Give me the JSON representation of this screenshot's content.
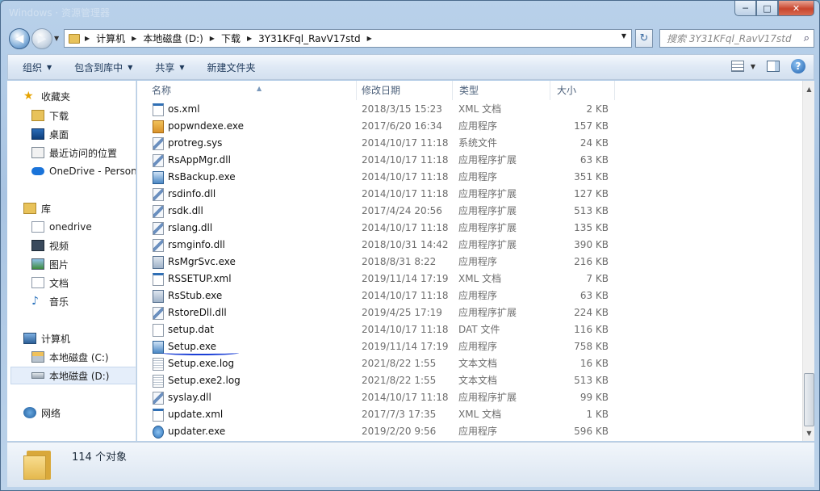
{
  "window": {
    "ghost_title": "Windows · 资源管理器",
    "controls": {
      "minimize": "─",
      "maximize": "□",
      "close": "✕"
    }
  },
  "nav": {
    "back_icon": "back-arrow-icon",
    "forward_icon": "forward-arrow-icon",
    "breadcrumb": [
      "计算机",
      "本地磁盘 (D:)",
      "下载",
      "3Y31KFql_RavV17std"
    ],
    "search_placeholder": "搜索 3Y31KFql_RavV17std"
  },
  "toolbar": {
    "organize": "组织",
    "include_in_library": "包含到库中",
    "share": "共享",
    "new_folder": "新建文件夹",
    "help": "?"
  },
  "sidebar": {
    "favorites": "收藏夹",
    "favorites_items": [
      "下载",
      "桌面",
      "最近访问的位置",
      "OneDrive - Personal"
    ],
    "libraries": "库",
    "library_items": [
      "onedrive",
      "视频",
      "图片",
      "文档",
      "音乐"
    ],
    "computer": "计算机",
    "computer_items": [
      "本地磁盘 (C:)",
      "本地磁盘 (D:)"
    ],
    "network": "网络"
  },
  "columns": {
    "name": "名称",
    "date": "修改日期",
    "type": "类型",
    "size": "大小"
  },
  "files": [
    {
      "name": "os.xml",
      "date": "2018/3/15 15:23",
      "type": "XML 文档",
      "size": "2 KB",
      "icon": "xml"
    },
    {
      "name": "popwndexe.exe",
      "date": "2017/6/20 16:34",
      "type": "应用程序",
      "size": "157 KB",
      "icon": "box"
    },
    {
      "name": "protreg.sys",
      "date": "2014/10/17 11:18",
      "type": "系统文件",
      "size": "24 KB",
      "icon": "dll"
    },
    {
      "name": "RsAppMgr.dll",
      "date": "2014/10/17 11:18",
      "type": "应用程序扩展",
      "size": "63 KB",
      "icon": "dll"
    },
    {
      "name": "RsBackup.exe",
      "date": "2014/10/17 11:18",
      "type": "应用程序",
      "size": "351 KB",
      "icon": "setup"
    },
    {
      "name": "rsdinfo.dll",
      "date": "2014/10/17 11:18",
      "type": "应用程序扩展",
      "size": "127 KB",
      "icon": "dll"
    },
    {
      "name": "rsdk.dll",
      "date": "2017/4/24 20:56",
      "type": "应用程序扩展",
      "size": "513 KB",
      "icon": "dll"
    },
    {
      "name": "rslang.dll",
      "date": "2014/10/17 11:18",
      "type": "应用程序扩展",
      "size": "135 KB",
      "icon": "dll"
    },
    {
      "name": "rsmginfo.dll",
      "date": "2018/10/31 14:42",
      "type": "应用程序扩展",
      "size": "390 KB",
      "icon": "dll"
    },
    {
      "name": "RsMgrSvc.exe",
      "date": "2018/8/31 8:22",
      "type": "应用程序",
      "size": "216 KB",
      "icon": "exe"
    },
    {
      "name": "RSSETUP.xml",
      "date": "2019/11/14 17:19",
      "type": "XML 文档",
      "size": "7 KB",
      "icon": "xml"
    },
    {
      "name": "RsStub.exe",
      "date": "2014/10/17 11:18",
      "type": "应用程序",
      "size": "63 KB",
      "icon": "exe"
    },
    {
      "name": "RstoreDll.dll",
      "date": "2019/4/25 17:19",
      "type": "应用程序扩展",
      "size": "224 KB",
      "icon": "dll"
    },
    {
      "name": "setup.dat",
      "date": "2014/10/17 11:18",
      "type": "DAT 文件",
      "size": "116 KB",
      "icon": "doc"
    },
    {
      "name": "Setup.exe",
      "date": "2019/11/14 17:19",
      "type": "应用程序",
      "size": "758 KB",
      "icon": "setup"
    },
    {
      "name": "Setup.exe.log",
      "date": "2021/8/22 1:55",
      "type": "文本文档",
      "size": "16 KB",
      "icon": "log"
    },
    {
      "name": "Setup.exe2.log",
      "date": "2021/8/22 1:55",
      "type": "文本文档",
      "size": "513 KB",
      "icon": "log"
    },
    {
      "name": "syslay.dll",
      "date": "2014/10/17 11:18",
      "type": "应用程序扩展",
      "size": "99 KB",
      "icon": "dll"
    },
    {
      "name": "update.xml",
      "date": "2017/7/3 17:35",
      "type": "XML 文档",
      "size": "1 KB",
      "icon": "xml"
    },
    {
      "name": "updater.exe",
      "date": "2019/2/20 9:56",
      "type": "应用程序",
      "size": "596 KB",
      "icon": "upd"
    }
  ],
  "status": {
    "count": "114 个对象"
  }
}
